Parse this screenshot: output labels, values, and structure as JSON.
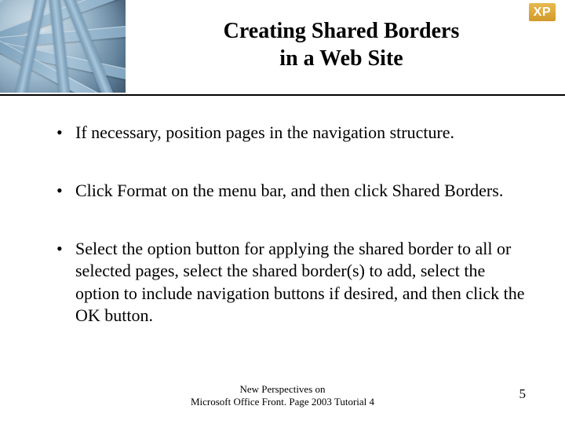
{
  "header": {
    "badge": "XP",
    "title_line1": "Creating Shared Borders",
    "title_line2": "in a Web Site"
  },
  "bullets": [
    "If necessary, position pages in the navigation structure.",
    "Click Format on the menu bar, and then click Shared Borders.",
    "Select the option button for applying the shared border to all or selected pages, select the shared border(s) to add, select the option to include navigation buttons if desired, and then click the OK button."
  ],
  "footer": {
    "line1": "New Perspectives on",
    "line2": "Microsoft Office Front. Page 2003 Tutorial 4"
  },
  "page_number": "5"
}
